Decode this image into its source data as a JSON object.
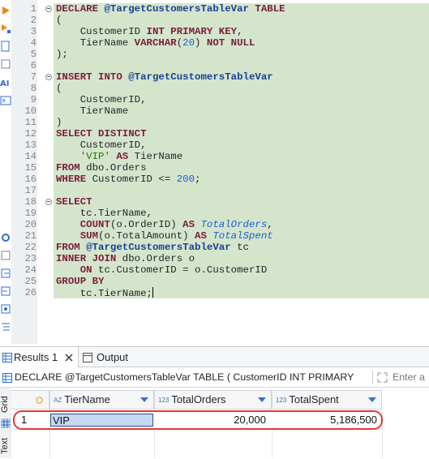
{
  "editor": {
    "lines": [
      {
        "n": "1",
        "fold": true,
        "segs": [
          [
            "kw",
            "DECLARE "
          ],
          [
            "vr",
            "@TargetCustomersTableVar"
          ],
          [
            "kw",
            " TABLE"
          ]
        ]
      },
      {
        "n": "2",
        "segs": [
          [
            "t",
            "("
          ]
        ]
      },
      {
        "n": "3",
        "segs": [
          [
            "t",
            "    CustomerID "
          ],
          [
            "kw",
            "INT PRIMARY KEY"
          ],
          [
            "t",
            ","
          ]
        ]
      },
      {
        "n": "4",
        "segs": [
          [
            "t",
            "    TierName "
          ],
          [
            "kw",
            "VARCHAR"
          ],
          [
            "t",
            "("
          ],
          [
            "num",
            "20"
          ],
          [
            "t",
            ") "
          ],
          [
            "kw",
            "NOT NULL"
          ]
        ]
      },
      {
        "n": "5",
        "segs": [
          [
            "t",
            ");"
          ]
        ]
      },
      {
        "n": "6",
        "segs": []
      },
      {
        "n": "7",
        "fold": true,
        "segs": [
          [
            "kw",
            "INSERT INTO "
          ],
          [
            "vr",
            "@TargetCustomersTableVar"
          ]
        ]
      },
      {
        "n": "8",
        "segs": [
          [
            "t",
            "("
          ]
        ]
      },
      {
        "n": "9",
        "segs": [
          [
            "t",
            "    CustomerID,"
          ]
        ]
      },
      {
        "n": "10",
        "segs": [
          [
            "t",
            "    TierName"
          ]
        ]
      },
      {
        "n": "11",
        "segs": [
          [
            "t",
            ")"
          ]
        ]
      },
      {
        "n": "12",
        "segs": [
          [
            "kw",
            "SELECT DISTINCT"
          ]
        ]
      },
      {
        "n": "13",
        "segs": [
          [
            "t",
            "    CustomerID,"
          ]
        ]
      },
      {
        "n": "14",
        "segs": [
          [
            "t",
            "    "
          ],
          [
            "str",
            "'VIP'"
          ],
          [
            "kw",
            " AS"
          ],
          [
            "t",
            " TierName"
          ]
        ]
      },
      {
        "n": "15",
        "segs": [
          [
            "kw",
            "FROM"
          ],
          [
            "t",
            " dbo.Orders"
          ]
        ]
      },
      {
        "n": "16",
        "segs": [
          [
            "kw",
            "WHERE"
          ],
          [
            "t",
            " CustomerID <= "
          ],
          [
            "num",
            "200"
          ],
          [
            "t",
            ";"
          ]
        ]
      },
      {
        "n": "17",
        "segs": []
      },
      {
        "n": "18",
        "fold": true,
        "segs": [
          [
            "kw",
            "SELECT"
          ]
        ]
      },
      {
        "n": "19",
        "segs": [
          [
            "t",
            "    tc.TierName,"
          ]
        ]
      },
      {
        "n": "20",
        "segs": [
          [
            "t",
            "    "
          ],
          [
            "kw",
            "COUNT"
          ],
          [
            "t",
            "(o.OrderID) "
          ],
          [
            "kw",
            "AS"
          ],
          [
            "t",
            " "
          ],
          [
            "ali",
            "TotalOrders"
          ],
          [
            "t",
            ","
          ]
        ]
      },
      {
        "n": "21",
        "segs": [
          [
            "t",
            "    "
          ],
          [
            "kw",
            "SUM"
          ],
          [
            "t",
            "(o.TotalAmount) "
          ],
          [
            "kw",
            "AS"
          ],
          [
            "t",
            " "
          ],
          [
            "ali",
            "TotalSpent"
          ]
        ]
      },
      {
        "n": "22",
        "segs": [
          [
            "kw",
            "FROM "
          ],
          [
            "vr",
            "@TargetCustomersTableVar"
          ],
          [
            "t",
            " tc"
          ]
        ]
      },
      {
        "n": "23",
        "segs": [
          [
            "kw",
            "INNER JOIN"
          ],
          [
            "t",
            " dbo.Orders o"
          ]
        ]
      },
      {
        "n": "24",
        "segs": [
          [
            "t",
            "    "
          ],
          [
            "kw",
            "ON"
          ],
          [
            "t",
            " tc.CustomerID = o.CustomerID"
          ]
        ]
      },
      {
        "n": "25",
        "segs": [
          [
            "kw",
            "GROUP BY"
          ]
        ]
      },
      {
        "n": "26",
        "cursor": true,
        "segs": [
          [
            "t",
            "    tc.TierName;"
          ]
        ]
      }
    ]
  },
  "tabs": {
    "results_label": "Results 1",
    "output_label": "Output"
  },
  "query_bar": {
    "text": "DECLARE @TargetCustomersTableVar TABLE ( CustomerID INT PRIMARY",
    "filter_placeholder": "Enter a"
  },
  "side_tabs": {
    "grid": "Grid",
    "text": "Text"
  },
  "grid": {
    "columns": [
      {
        "type": "AZ",
        "label": "TierName"
      },
      {
        "type": "123",
        "label": "TotalOrders"
      },
      {
        "type": "123",
        "label": "TotalSpent"
      }
    ],
    "rows": [
      {
        "num": "1",
        "cells": [
          "VIP",
          "20,000",
          "5,186,500"
        ]
      }
    ]
  },
  "colors": {
    "accent": "#3c6fd6",
    "selection_highlight": "#e53935",
    "code_background": "#d4e5cc"
  }
}
